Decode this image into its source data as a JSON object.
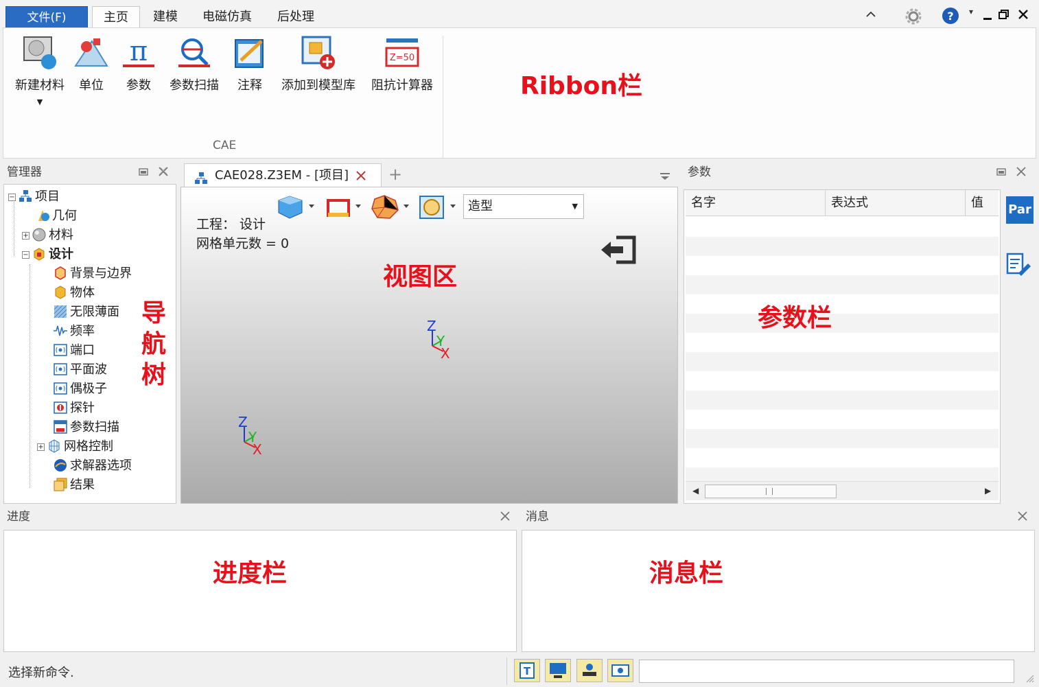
{
  "menu": {
    "file": "文件(F)",
    "tabs": [
      "主页",
      "建模",
      "电磁仿真",
      "后处理"
    ],
    "active_tab": "主页"
  },
  "ribbon": {
    "buttons": [
      {
        "label": "新建材料",
        "icon": "new-material-icon"
      },
      {
        "label": "单位",
        "icon": "unit-icon"
      },
      {
        "label": "参数",
        "icon": "parameter-pi-icon"
      },
      {
        "label": "参数扫描",
        "icon": "parameter-sweep-icon"
      },
      {
        "label": "注释",
        "icon": "annotation-icon"
      },
      {
        "label": "添加到模型库",
        "icon": "add-to-library-icon"
      },
      {
        "label": "阻抗计算器",
        "icon": "impedance-calculator-icon"
      }
    ],
    "group_label": "CAE",
    "annotation": "Ribbon栏"
  },
  "manager": {
    "title": "管理器",
    "annotation": [
      "导",
      "航",
      "树"
    ],
    "tree": [
      {
        "label": "项目",
        "bold": false
      },
      {
        "label": "几何",
        "bold": false
      },
      {
        "label": "材料",
        "bold": false
      },
      {
        "label": "设计",
        "bold": true
      },
      {
        "label": "背景与边界",
        "bold": false
      },
      {
        "label": "物体",
        "bold": false
      },
      {
        "label": "无限薄面",
        "bold": false
      },
      {
        "label": "频率",
        "bold": false
      },
      {
        "label": "端口",
        "bold": false
      },
      {
        "label": "平面波",
        "bold": false
      },
      {
        "label": "偶极子",
        "bold": false
      },
      {
        "label": "探针",
        "bold": false
      },
      {
        "label": "参数扫描",
        "bold": false
      },
      {
        "label": "网格控制",
        "bold": false
      },
      {
        "label": "求解器选项",
        "bold": false
      },
      {
        "label": "结果",
        "bold": false
      }
    ]
  },
  "view": {
    "doc_tab": "CAE028.Z3EM - [项目]",
    "add_tab": "+",
    "select_value": "造型",
    "project_line": "工程： 设计",
    "mesh_line": "网格单元数 = 0",
    "annotation": "视图区",
    "axis_labels": {
      "z": "Z",
      "y": "Y",
      "x": "X"
    }
  },
  "params": {
    "title": "参数",
    "columns": [
      "名字",
      "表达式",
      "值"
    ],
    "side_tab": "Par",
    "annotation": "参数栏"
  },
  "progress": {
    "title": "进度",
    "annotation": "进度栏"
  },
  "messages": {
    "title": "消息",
    "annotation": "消息栏"
  },
  "status": {
    "text": "选择新命令."
  }
}
